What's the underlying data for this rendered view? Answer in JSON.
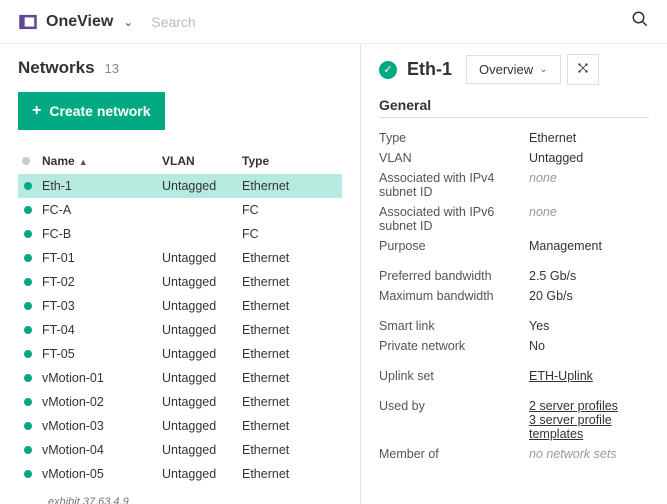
{
  "header": {
    "app_title": "OneView",
    "search_placeholder": "Search"
  },
  "page": {
    "title": "Networks",
    "count": "13",
    "create_label": "Create network",
    "exhibit": "exhibit 37.63.4.9"
  },
  "table": {
    "headers": {
      "name": "Name",
      "vlan": "VLAN",
      "type": "Type"
    },
    "rows": [
      {
        "name": "Eth-1",
        "vlan": "Untagged",
        "type": "Ethernet",
        "selected": true
      },
      {
        "name": "FC-A",
        "vlan": "",
        "type": "FC"
      },
      {
        "name": "FC-B",
        "vlan": "",
        "type": "FC"
      },
      {
        "name": "FT-01",
        "vlan": "Untagged",
        "type": "Ethernet"
      },
      {
        "name": "FT-02",
        "vlan": "Untagged",
        "type": "Ethernet"
      },
      {
        "name": "FT-03",
        "vlan": "Untagged",
        "type": "Ethernet"
      },
      {
        "name": "FT-04",
        "vlan": "Untagged",
        "type": "Ethernet"
      },
      {
        "name": "FT-05",
        "vlan": "Untagged",
        "type": "Ethernet"
      },
      {
        "name": "vMotion-01",
        "vlan": "Untagged",
        "type": "Ethernet"
      },
      {
        "name": "vMotion-02",
        "vlan": "Untagged",
        "type": "Ethernet"
      },
      {
        "name": "vMotion-03",
        "vlan": "Untagged",
        "type": "Ethernet"
      },
      {
        "name": "vMotion-04",
        "vlan": "Untagged",
        "type": "Ethernet"
      },
      {
        "name": "vMotion-05",
        "vlan": "Untagged",
        "type": "Ethernet"
      }
    ]
  },
  "detail": {
    "title": "Eth-1",
    "view_selector": "Overview",
    "section": "General",
    "props": [
      {
        "label": "Type",
        "value": "Ethernet"
      },
      {
        "label": "VLAN",
        "value": "Untagged"
      },
      {
        "label": "Associated with IPv4 subnet ID",
        "value": "none",
        "none": true
      },
      {
        "label": "Associated with IPv6 subnet ID",
        "value": "none",
        "none": true
      },
      {
        "label": "Purpose",
        "value": "Management"
      }
    ],
    "props2": [
      {
        "label": "Preferred bandwidth",
        "value": "2.5 Gb/s"
      },
      {
        "label": "Maximum bandwidth",
        "value": "20 Gb/s"
      }
    ],
    "props3": [
      {
        "label": "Smart link",
        "value": "Yes"
      },
      {
        "label": "Private network",
        "value": "No"
      }
    ],
    "props4": [
      {
        "label": "Uplink set",
        "value": "ETH-Uplink",
        "link": true
      }
    ],
    "props5": [
      {
        "label": "Used by",
        "links": [
          "2 server profiles",
          "3 server profile templates"
        ]
      },
      {
        "label": "Member of",
        "value": "no network sets",
        "none": true
      }
    ]
  }
}
